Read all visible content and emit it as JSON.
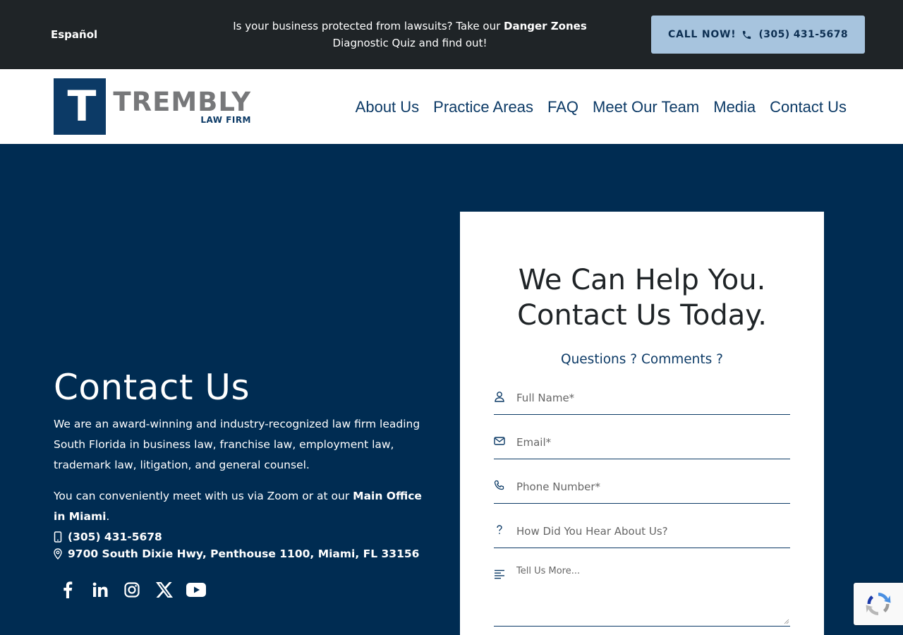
{
  "topbar": {
    "language_link": "Español",
    "promo_prefix": "Is your business protected from lawsuits? Take our ",
    "promo_bold": "Danger Zones",
    "promo_suffix": " Diagnostic Quiz and find out!",
    "call_label": "CALL NOW!",
    "call_number": "(305) 431-5678"
  },
  "header": {
    "logo_letter": "T",
    "logo_name": "TREMBLY",
    "logo_sub": "LAW FIRM",
    "nav": [
      "About Us",
      "Practice Areas",
      "FAQ",
      "Meet Our Team",
      "Media",
      "Contact Us"
    ]
  },
  "left": {
    "title": "Contact Us",
    "intro": "We are an award-winning and industry-recognized law firm leading South Florida in business law, franchise law, employment law, trademark law, litigation, and general counsel.",
    "meet_prefix": "You can conveniently meet with us via Zoom or at our ",
    "meet_bold": "Main Office in Miami",
    "meet_suffix": ".",
    "phone": "(305) 431-5678",
    "address": "9700 South Dixie Hwy, Penthouse 1100, Miami, FL 33156",
    "socials": [
      "facebook-icon",
      "linkedin-icon",
      "instagram-icon",
      "x-icon",
      "youtube-icon"
    ]
  },
  "form": {
    "title_line1": "We Can Help You.",
    "title_line2": "Contact Us Today.",
    "subtitle": "Questions ? Comments ?",
    "full_name_placeholder": "Full Name*",
    "email_placeholder": "Email*",
    "phone_placeholder": "Phone Number*",
    "hear_placeholder": "How Did You Hear About Us?",
    "more_placeholder": "Tell Us More..."
  },
  "colors": {
    "page_bg": "#002c52",
    "topbar_bg": "#1f2427",
    "call_button_bg": "#a7c4de",
    "brand_navy": "#0c3a66",
    "logo_gray": "#77787a"
  }
}
